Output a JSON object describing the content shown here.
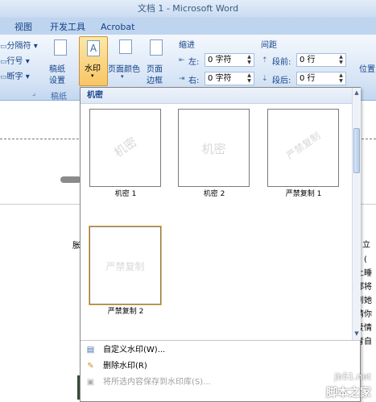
{
  "window": {
    "title": "文档 1 - Microsoft Word"
  },
  "tabs": [
    "视图",
    "开发工具",
    "Acrobat"
  ],
  "ribbon": {
    "left_items": [
      "分隔符 ▾",
      "行号 ▾",
      "断字 ▾"
    ],
    "gaozhi": {
      "line1": "稿纸",
      "line2": "设置",
      "group": "稿纸"
    },
    "watermark": {
      "label": "水印",
      "arrow": "▾"
    },
    "page_color": {
      "line1": "页面颜色",
      "arrow": "▾"
    },
    "page_border": {
      "line1": "页面",
      "line2": "边框"
    },
    "indent": {
      "title": "缩进",
      "left_label": "左:",
      "left_value": "0 字符",
      "right_label": "右:",
      "right_value": "0 字符"
    },
    "spacing": {
      "title": "间距",
      "before_label": "段前:",
      "before_value": "0 行",
      "after_label": "段后:",
      "after_value": "0 行"
    },
    "position": {
      "label": "位置"
    }
  },
  "gallery": {
    "header": "机密",
    "items": [
      {
        "caption": "机密 1",
        "watermark": "机密"
      },
      {
        "caption": "机密 2",
        "watermark": "机密"
      },
      {
        "caption": "严禁复制 1",
        "watermark": "严禁复制"
      },
      {
        "caption": "严禁复制 2",
        "watermark": "严禁复制"
      }
    ],
    "menu": [
      {
        "label": "自定义水印(W)...",
        "enabled": true
      },
      {
        "label": "删除水印(R)",
        "enabled": true
      },
      {
        "label": "将所选内容保存到水印库(S)...",
        "enabled": false
      }
    ]
  },
  "document": {
    "right_text": [
      "立",
      "，( ",
      "上睡",
      "都将",
      "到她",
      "请你",
      "爱情",
      "青自"
    ],
    "left_text": "胀"
  },
  "watermark_site": {
    "line1": "jb51.net",
    "line2": "脚本之家"
  }
}
